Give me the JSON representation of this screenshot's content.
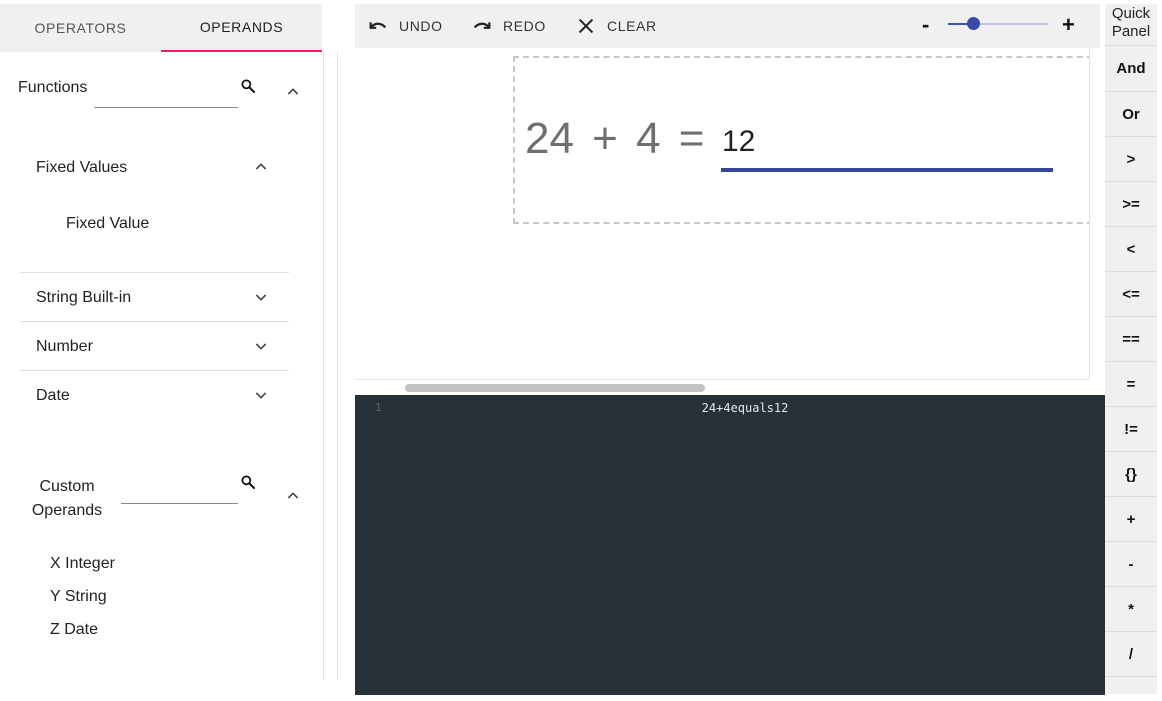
{
  "tabs": [
    {
      "label": "OPERATORS",
      "active": false
    },
    {
      "label": "OPERANDS",
      "active": true
    }
  ],
  "functions": {
    "title": "Functions",
    "search_placeholder": "",
    "groups": [
      {
        "label": "Fixed Values",
        "expanded": true,
        "items": [
          "Fixed Value"
        ]
      },
      {
        "label": "String Built-in",
        "expanded": false
      },
      {
        "label": "Number",
        "expanded": false
      },
      {
        "label": "Date",
        "expanded": false
      }
    ]
  },
  "custom_operands": {
    "title_line1": "Custom",
    "title_line2": "Operands",
    "search_placeholder": "",
    "items": [
      "X Integer",
      "Y String",
      "Z Date"
    ]
  },
  "toolbar": {
    "undo_label": "UNDO",
    "redo_label": "REDO",
    "clear_label": "CLEAR",
    "zoom_minus": "-",
    "zoom_plus": "+",
    "zoom_level": 0.25
  },
  "canvas": {
    "expression": "24 + 4 =",
    "result_value": "12"
  },
  "editor": {
    "line_number": "1",
    "code": "24+4equals12"
  },
  "quick_panel": {
    "title_line1": "Quick",
    "title_line2": "Panel",
    "buttons": [
      "And",
      "Or",
      ">",
      ">=",
      "<",
      "<=",
      "==",
      "=",
      "!=",
      "{}",
      "+",
      "-",
      "*",
      "/"
    ]
  },
  "colors": {
    "tab_indicator": "#e91e63",
    "accent": "#3f51b5",
    "result_underline": "#34479a",
    "editor_bg": "#263238"
  }
}
